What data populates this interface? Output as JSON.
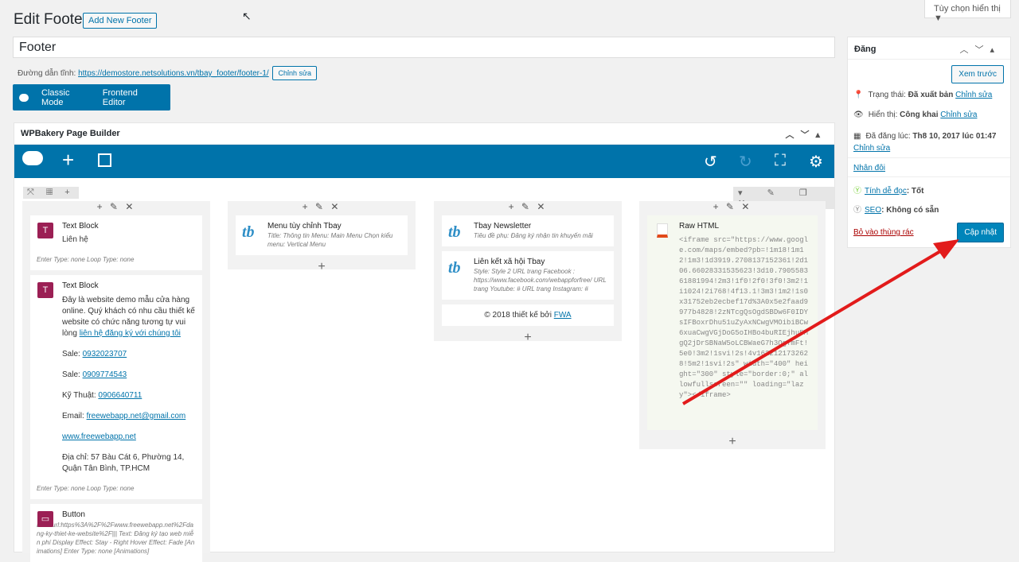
{
  "page": {
    "title": "Edit Footer",
    "add_new": "Add New Footer",
    "screen_options": "Tùy chọn hiển thị ▼"
  },
  "post": {
    "title": "Footer",
    "permalink_label": "Đường dẫn tĩnh:",
    "permalink_url": "https://demostore.netsolutions.vn/tbay_footer/footer-1/",
    "edit": "Chỉnh sửa"
  },
  "modes": {
    "classic": "Classic Mode",
    "frontend": "Frontend Editor"
  },
  "wpb": {
    "title": "WPBakery Page Builder"
  },
  "col1": {
    "tb1_title": "Text Block",
    "tb1_text": "Liên hệ",
    "meta": "Enter Type: none    Loop Type: none",
    "tb2_title": "Text Block",
    "tb2_intro": "Đây là website demo mẫu cửa hàng online. Quý khách có nhu cầu thiết kế website có chức năng tương tự vui lòng",
    "tb2_link": "liên hệ đăng ký với chúng tôi",
    "sale1_label": "Sale: ",
    "sale1": "0932023707",
    "sale2_label": "Sale: ",
    "sale2": "0909774543",
    "tech_label": "Kỹ Thuật: ",
    "tech": "0906640711",
    "email_label": "Email: ",
    "email": "freewebapp.net@gmail.com",
    "web": "www.freewebapp.net",
    "address": "Địa chỉ: 57 Bàu Cát 6, Phường 14, Quận Tân Bình, TP.HCM",
    "meta2": "Enter Type: none    Loop Type: none",
    "btn_title": "Button",
    "btn_meta": "Link: url:https%3A%2F%2Fwww.freewebapp.net%2Fdang-ky-thiet-ke-website%2F|||  Text: Đăng ký tạo web miễn phí  Display Effect: Stay - Right  Hover Effect: Fade  [Animations] Enter Type: none  [Animations]"
  },
  "col2": {
    "title": "Menu tùy chỉnh Tbay",
    "meta": "Title: Thông tin  Menu: Main Menu  Chọn kiểu menu: Vertical Menu"
  },
  "col3": {
    "n_title": "Tbay Newsletter",
    "n_meta": "Tiêu đề phụ: Đăng ký nhận tin khuyến mãi",
    "s_title": "Liên kết xã hội Tbay",
    "s_meta": "Style: Style 2  URL trang Facebook : https://www.facebook.com/webappforfree/  URL trang Youtube: #  URL trang Instagram: #",
    "copy": "© 2018 thiết kế bởi ",
    "copy_link": "FWA"
  },
  "col4": {
    "title": "Raw HTML",
    "code": "<iframe src=\"https://www.google.com/maps/embed?pb=!1m18!1m12!1m3!1d3919.2708137152361!2d106.66028331535623!3d10.790558361881994!2m3!1f0!2f0!3f0!3m2!1i1024!2i768!4f13.1!3m3!1m2!1s0x31752eb2ecbef17d%3A0x5e2faad9977b4828!2zNTcgQsOgdSBDw6F0IDYsIFBoxrDhu51uZyAxNCwgVMOibiBCw6xuaCwgVGjDoG5oIHBo4buRIEjhu5MgQ2jDrSBNaW5oLCBWaeG7h3QgTmFt!5e0!3m2!1svi!2s!4v1622121732628!5m2!1svi!2s\" width=\"400\" height=\"300\" style=\"border:0;\" allowfullscreen=\"\" loading=\"lazy\"></iframe>"
  },
  "sidebar": {
    "title": "Đăng",
    "preview": "Xem trước",
    "status_label": "Trạng thái: ",
    "status": "Đã xuất bản",
    "status_edit": "Chỉnh sửa",
    "vis_label": "Hiển thị: ",
    "vis": "Công khai",
    "vis_edit": "Chỉnh sửa",
    "date_label": "Đã đăng lúc: ",
    "date": "Th8 10, 2017 lúc 01:47",
    "date_edit": "Chỉnh sửa",
    "dup": "Nhân đôi",
    "read_label": "Tính dễ đọc",
    "read": ": Tốt",
    "seo_label": "SEO",
    "seo": ": Không có sẵn",
    "trash": "Bỏ vào thùng rác",
    "update": "Cập nhật"
  }
}
